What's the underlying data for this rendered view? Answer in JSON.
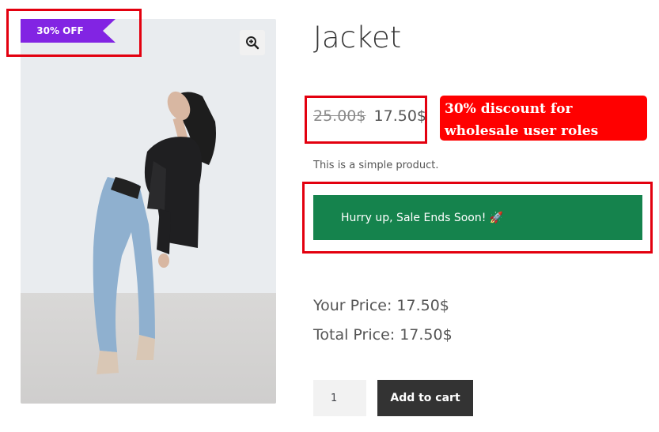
{
  "product": {
    "title": "Jacket",
    "sale_badge": "30% OFF",
    "regular_price": "25.00$",
    "sale_price": "17.50$",
    "short_description": "This is a simple product.",
    "discount_note": "30% discount for wholesale user roles",
    "sale_banner": "Hurry up, Sale Ends Soon! 🚀",
    "your_price": "Your Price: 17.50$",
    "total_price": "Total Price: 17.50$",
    "quantity": "1",
    "add_to_cart_label": "Add to cart",
    "zoom_icon": "zoom-in-icon",
    "image_subject": "product-photo"
  },
  "colors": {
    "badge": "#8224e3",
    "highlight_border": "#e3000f",
    "discount_note_bg": "#ff0000",
    "banner_bg": "#15834d",
    "button_bg": "#333333"
  }
}
